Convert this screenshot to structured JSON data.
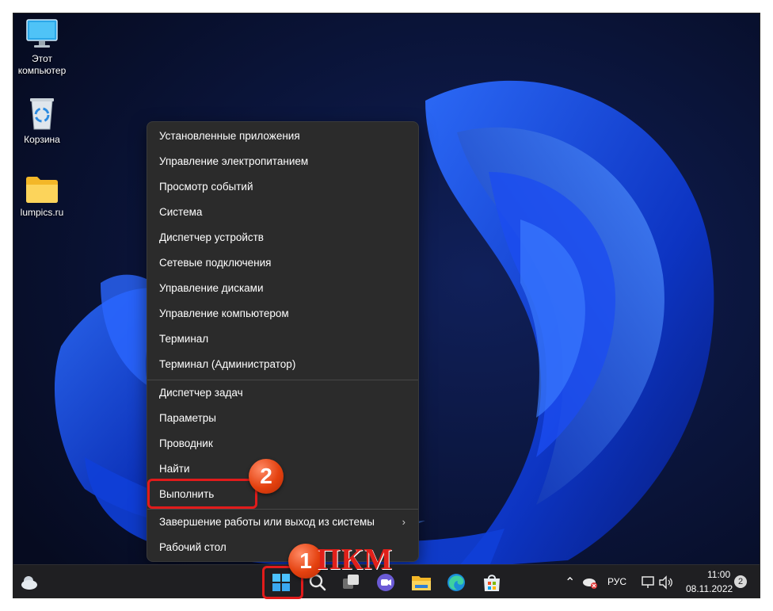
{
  "desktop": {
    "icons": [
      {
        "label_line1": "Этот",
        "label_line2": "компьютер",
        "icon": "monitor-icon"
      },
      {
        "label": "Корзина",
        "icon": "recycle-bin-icon"
      },
      {
        "label": "lumpics.ru",
        "icon": "folder-icon"
      }
    ]
  },
  "context_menu": {
    "items": [
      {
        "label": "Установленные приложения"
      },
      {
        "label": "Управление электропитанием"
      },
      {
        "label": "Просмотр событий"
      },
      {
        "label": "Система"
      },
      {
        "label": "Диспетчер устройств"
      },
      {
        "label": "Сетевые подключения"
      },
      {
        "label": "Управление дисками"
      },
      {
        "label": "Управление компьютером"
      },
      {
        "label": "Терминал"
      },
      {
        "label": "Терминал (Администратор)"
      },
      {
        "label": "Диспетчер задач"
      },
      {
        "label": "Параметры"
      },
      {
        "label": "Проводник"
      },
      {
        "label": "Найти"
      },
      {
        "label": "Выполнить"
      },
      {
        "label": "Завершение работы или выход из системы",
        "submenu": true
      },
      {
        "label": "Рабочий стол"
      }
    ]
  },
  "taskbar": {
    "icons": [
      "weather-icon",
      "start-icon",
      "search-icon",
      "task-view-icon",
      "chat-icon",
      "file-explorer-icon",
      "edge-icon",
      "store-icon"
    ],
    "tray": {
      "language": "РУС",
      "time": "11:00",
      "date": "08.11.2022",
      "notification_count": "2"
    }
  },
  "annotations": {
    "step1": "1",
    "step2": "2",
    "pkm_label": "ПКМ",
    "highlight_color": "#e11b1b"
  }
}
